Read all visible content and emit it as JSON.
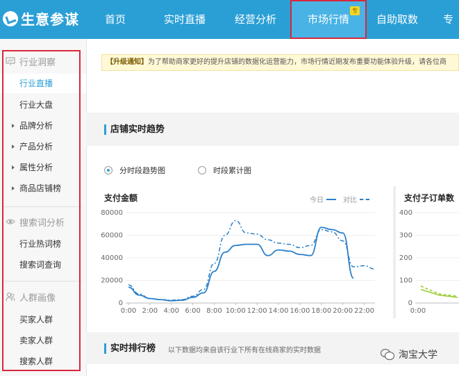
{
  "app": {
    "logo_text": "生意参谋"
  },
  "nav": {
    "items": [
      "首页",
      "实时直播",
      "经营分析",
      "市场行情",
      "自助取数",
      "专"
    ],
    "active": "市场行情",
    "active_badge": "专"
  },
  "sidebar": {
    "groups": [
      {
        "title": "行业洞察",
        "icon": "monitor-icon",
        "items": [
          {
            "label": "行业直播",
            "active": true,
            "arrow": false
          },
          {
            "label": "行业大盘",
            "arrow": false
          },
          {
            "label": "品牌分析",
            "arrow": true
          },
          {
            "label": "产品分析",
            "arrow": true
          },
          {
            "label": "属性分析",
            "arrow": true
          },
          {
            "label": "商品店铺榜",
            "arrow": true
          }
        ]
      },
      {
        "title": "搜索词分析",
        "icon": "eye-icon",
        "items": [
          {
            "label": "行业热词榜"
          },
          {
            "label": "搜索词查询"
          }
        ]
      },
      {
        "title": "人群画像",
        "icon": "people-icon",
        "items": [
          {
            "label": "买家人群"
          },
          {
            "label": "卖家人群"
          },
          {
            "label": "搜索人群"
          }
        ]
      }
    ]
  },
  "notice": {
    "tag": "【升级通知】",
    "text": "为了帮助商家更好的提升店铺的数据化运营能力，市场行情近期发布重要功能体验升级，请各位商"
  },
  "trend": {
    "title": "店铺实时趋势",
    "radio_options": [
      "分时段趋势图",
      "时段累计图"
    ],
    "selected": "分时段趋势图"
  },
  "rank": {
    "title": "实时排行榜",
    "subtitle": "以下数据均来自该行业下所有在线商家的实时数据"
  },
  "watermark": "淘宝大学",
  "colors": {
    "nav_bg": "#2a9fd6",
    "accent": "#2a9fd6",
    "highlight_border": "#d9263b",
    "side_chart": "#9acd32"
  },
  "chart_data": [
    {
      "type": "line",
      "title": "支付金额",
      "legend": [
        "今日",
        "对比"
      ],
      "x_ticks": [
        "0:00",
        "2:00",
        "4:00",
        "6:00",
        "8:00",
        "10:00",
        "12:00",
        "14:00",
        "16:00",
        "18:00",
        "20:00",
        "22:00"
      ],
      "y_ticks": [
        "0",
        "20000",
        "40000",
        "60000",
        "80000"
      ],
      "ylim": [
        0,
        80000
      ],
      "x_hours": [
        0,
        1,
        2,
        3,
        4,
        5,
        6,
        7,
        8,
        9,
        10,
        11,
        12,
        13,
        14,
        15,
        16,
        17,
        18,
        19,
        20,
        21,
        22,
        23
      ],
      "series": [
        {
          "name": "今日",
          "style": "solid",
          "values": [
            14000,
            7000,
            4000,
            3000,
            2000,
            2500,
            5000,
            9000,
            28000,
            45000,
            51000,
            52000,
            52000,
            42000,
            47000,
            46000,
            43000,
            42000,
            67000,
            65000,
            62000,
            22000
          ]
        },
        {
          "name": "对比",
          "style": "dashed",
          "values": [
            16000,
            8000,
            4000,
            3000,
            2500,
            3000,
            6000,
            12000,
            35000,
            60000,
            73000,
            62000,
            61000,
            56000,
            53000,
            52000,
            49000,
            51000,
            65000,
            63000,
            55000,
            32000,
            33000,
            30000
          ]
        }
      ]
    },
    {
      "type": "line",
      "title": "支付子订单数",
      "x_ticks": [
        "0:00"
      ],
      "y_ticks": [
        "0",
        "100",
        "200",
        "300",
        "400"
      ],
      "ylim": [
        0,
        400
      ],
      "series": [
        {
          "name": "今日",
          "style": "solid",
          "values": [
            60,
            35,
            25
          ]
        },
        {
          "name": "对比",
          "style": "dashed",
          "values": [
            75,
            40,
            30
          ]
        }
      ]
    }
  ]
}
